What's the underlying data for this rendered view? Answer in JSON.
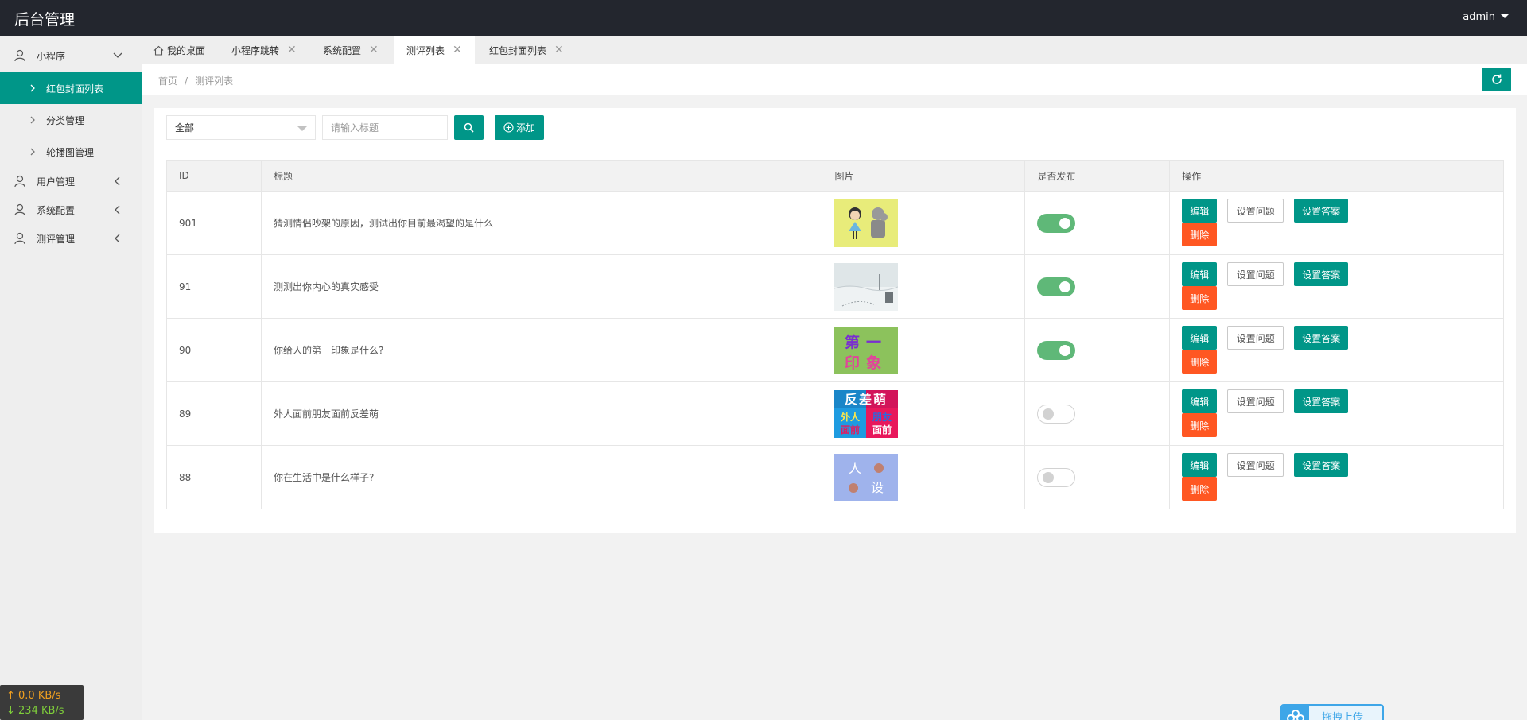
{
  "header": {
    "title": "后台管理",
    "user": "admin"
  },
  "sidebar": {
    "groups": [
      {
        "label": "小程序",
        "expanded": true
      },
      {
        "label": "用户管理"
      },
      {
        "label": "系统配置"
      },
      {
        "label": "测评管理"
      }
    ],
    "sub_items": [
      {
        "label": "红包封面列表",
        "active": true
      },
      {
        "label": "分类管理"
      },
      {
        "label": "轮播图管理"
      }
    ]
  },
  "tabs": [
    {
      "label": "我的桌面"
    },
    {
      "label": "小程序跳转"
    },
    {
      "label": "系统配置"
    },
    {
      "label": "测评列表",
      "active": true
    },
    {
      "label": "红包封面列表"
    }
  ],
  "breadcrumb": {
    "home": "首页",
    "sep": "/",
    "current": "测评列表"
  },
  "filter": {
    "select_value": "全部",
    "search_placeholder": "请输入标题",
    "add_label": "添加"
  },
  "table": {
    "headers": [
      "ID",
      "标题",
      "图片",
      "是否发布",
      "操作"
    ],
    "actions": {
      "edit": "编辑",
      "questions": "设置问题",
      "answers": "设置答案",
      "delete": "删除"
    },
    "rows": [
      {
        "id": "901",
        "title": "猜测情侣吵架的原因，测试出你目前最渴望的是什么",
        "published": true
      },
      {
        "id": "91",
        "title": "测测出你内心的真实感受",
        "published": true
      },
      {
        "id": "90",
        "title": "你给人的第一印象是什么?",
        "published": true,
        "thumb_text": "第一印象"
      },
      {
        "id": "89",
        "title": "外人面前朋友面前反差萌",
        "published": false,
        "thumb_text": "反差萌 外人面前 朋友面前"
      },
      {
        "id": "88",
        "title": "你在生活中是什么样子?",
        "published": false,
        "thumb_text": "人设"
      }
    ]
  },
  "net_speed": {
    "up": "↑ 0.0 KB/s",
    "down": "↓ 234 KB/s"
  },
  "upload_widget": {
    "label": "拖拽上传"
  },
  "colors": {
    "primary": "#009688",
    "danger": "#ff5722",
    "switch_on": "#5fb878",
    "header_bg": "#23262e"
  }
}
